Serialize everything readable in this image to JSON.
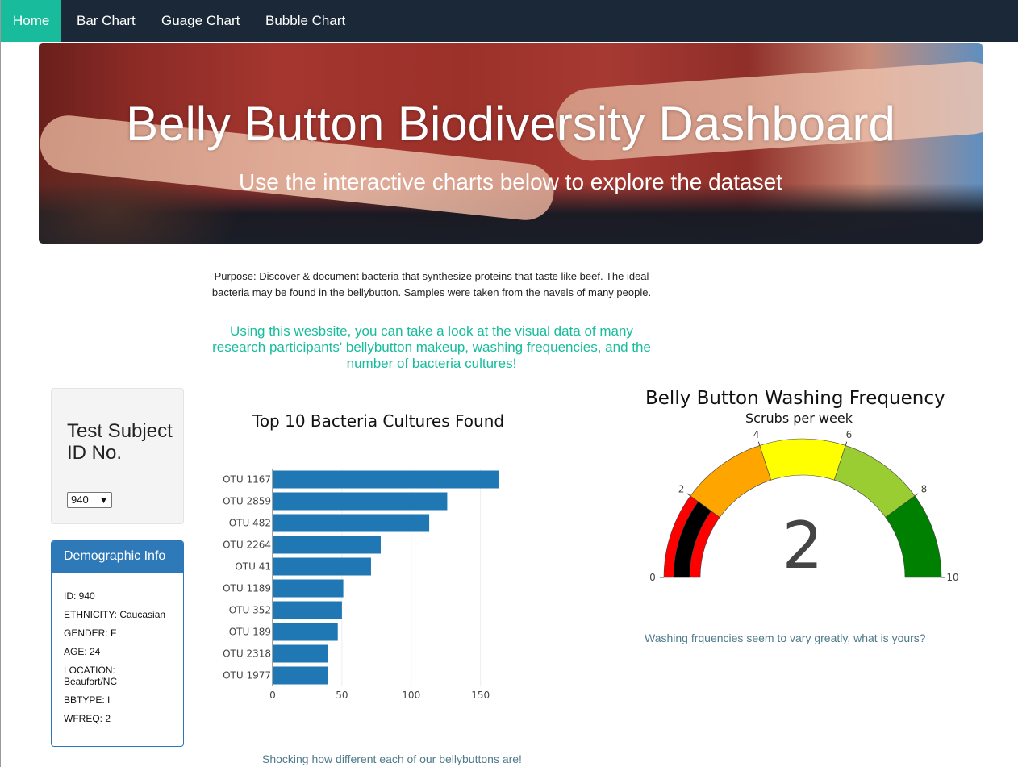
{
  "nav": {
    "items": [
      {
        "label": "Home",
        "active": true
      },
      {
        "label": "Bar Chart",
        "active": false
      },
      {
        "label": "Guage Chart",
        "active": false
      },
      {
        "label": "Bubble Chart",
        "active": false
      }
    ]
  },
  "hero": {
    "title": "Belly Button Biodiversity Dashboard",
    "subtitle": "Use the interactive charts below to explore the dataset"
  },
  "purpose": "Purpose: Discover & document bacteria that synthesize proteins that taste like beef. The ideal bacteria may be found in the bellybutton. Samples were taken from the navels of many people.",
  "intro": "Using this wesbsite, you can take a look at the visual data of many research participants' bellybutton makeup, washing frequencies, and the number of bacteria cultures!",
  "selector": {
    "title": "Test Subject ID No.",
    "selected": "940"
  },
  "demographics": {
    "heading": "Demographic Info",
    "lines": [
      "ID: 940",
      "ETHNICITY: Caucasian",
      "GENDER: F",
      "AGE: 24",
      "LOCATION: Beaufort/NC",
      "BBTYPE: I",
      "WFREQ: 2"
    ]
  },
  "bar_note": "Shocking how different each of our bellybuttons are!",
  "gauge_note": "Washing frquencies seem to vary greatly, what is yours?",
  "colors": {
    "nav_bg": "#1b2838",
    "accent": "#18bc9c",
    "panel": "#2e7ab8",
    "bar": "#1f77b4"
  },
  "chart_data": [
    {
      "type": "bar",
      "orientation": "horizontal",
      "title": "Top 10 Bacteria Cultures Found",
      "categories": [
        "OTU 1167",
        "OTU 2859",
        "OTU 482",
        "OTU 2264",
        "OTU 41",
        "OTU 1189",
        "OTU 352",
        "OTU 189",
        "OTU 2318",
        "OTU 1977"
      ],
      "values": [
        163,
        126,
        113,
        78,
        71,
        51,
        50,
        47,
        40,
        40
      ],
      "xlim": [
        0,
        170
      ],
      "xticks": [
        0,
        50,
        100,
        150
      ],
      "grid": true
    },
    {
      "type": "gauge",
      "title": "Belly Button Washing Frequency",
      "subtitle": "Scrubs per week",
      "value": 2,
      "range": [
        0,
        10
      ],
      "ticks": [
        0,
        2,
        4,
        6,
        8,
        10
      ],
      "steps": [
        {
          "range": [
            0,
            2
          ],
          "color": "#ff0000"
        },
        {
          "range": [
            2,
            4
          ],
          "color": "#ffa500"
        },
        {
          "range": [
            4,
            6
          ],
          "color": "#ffff00"
        },
        {
          "range": [
            6,
            8
          ],
          "color": "#9acd32"
        },
        {
          "range": [
            8,
            10
          ],
          "color": "#008000"
        }
      ],
      "bar_color": "#000000"
    }
  ]
}
